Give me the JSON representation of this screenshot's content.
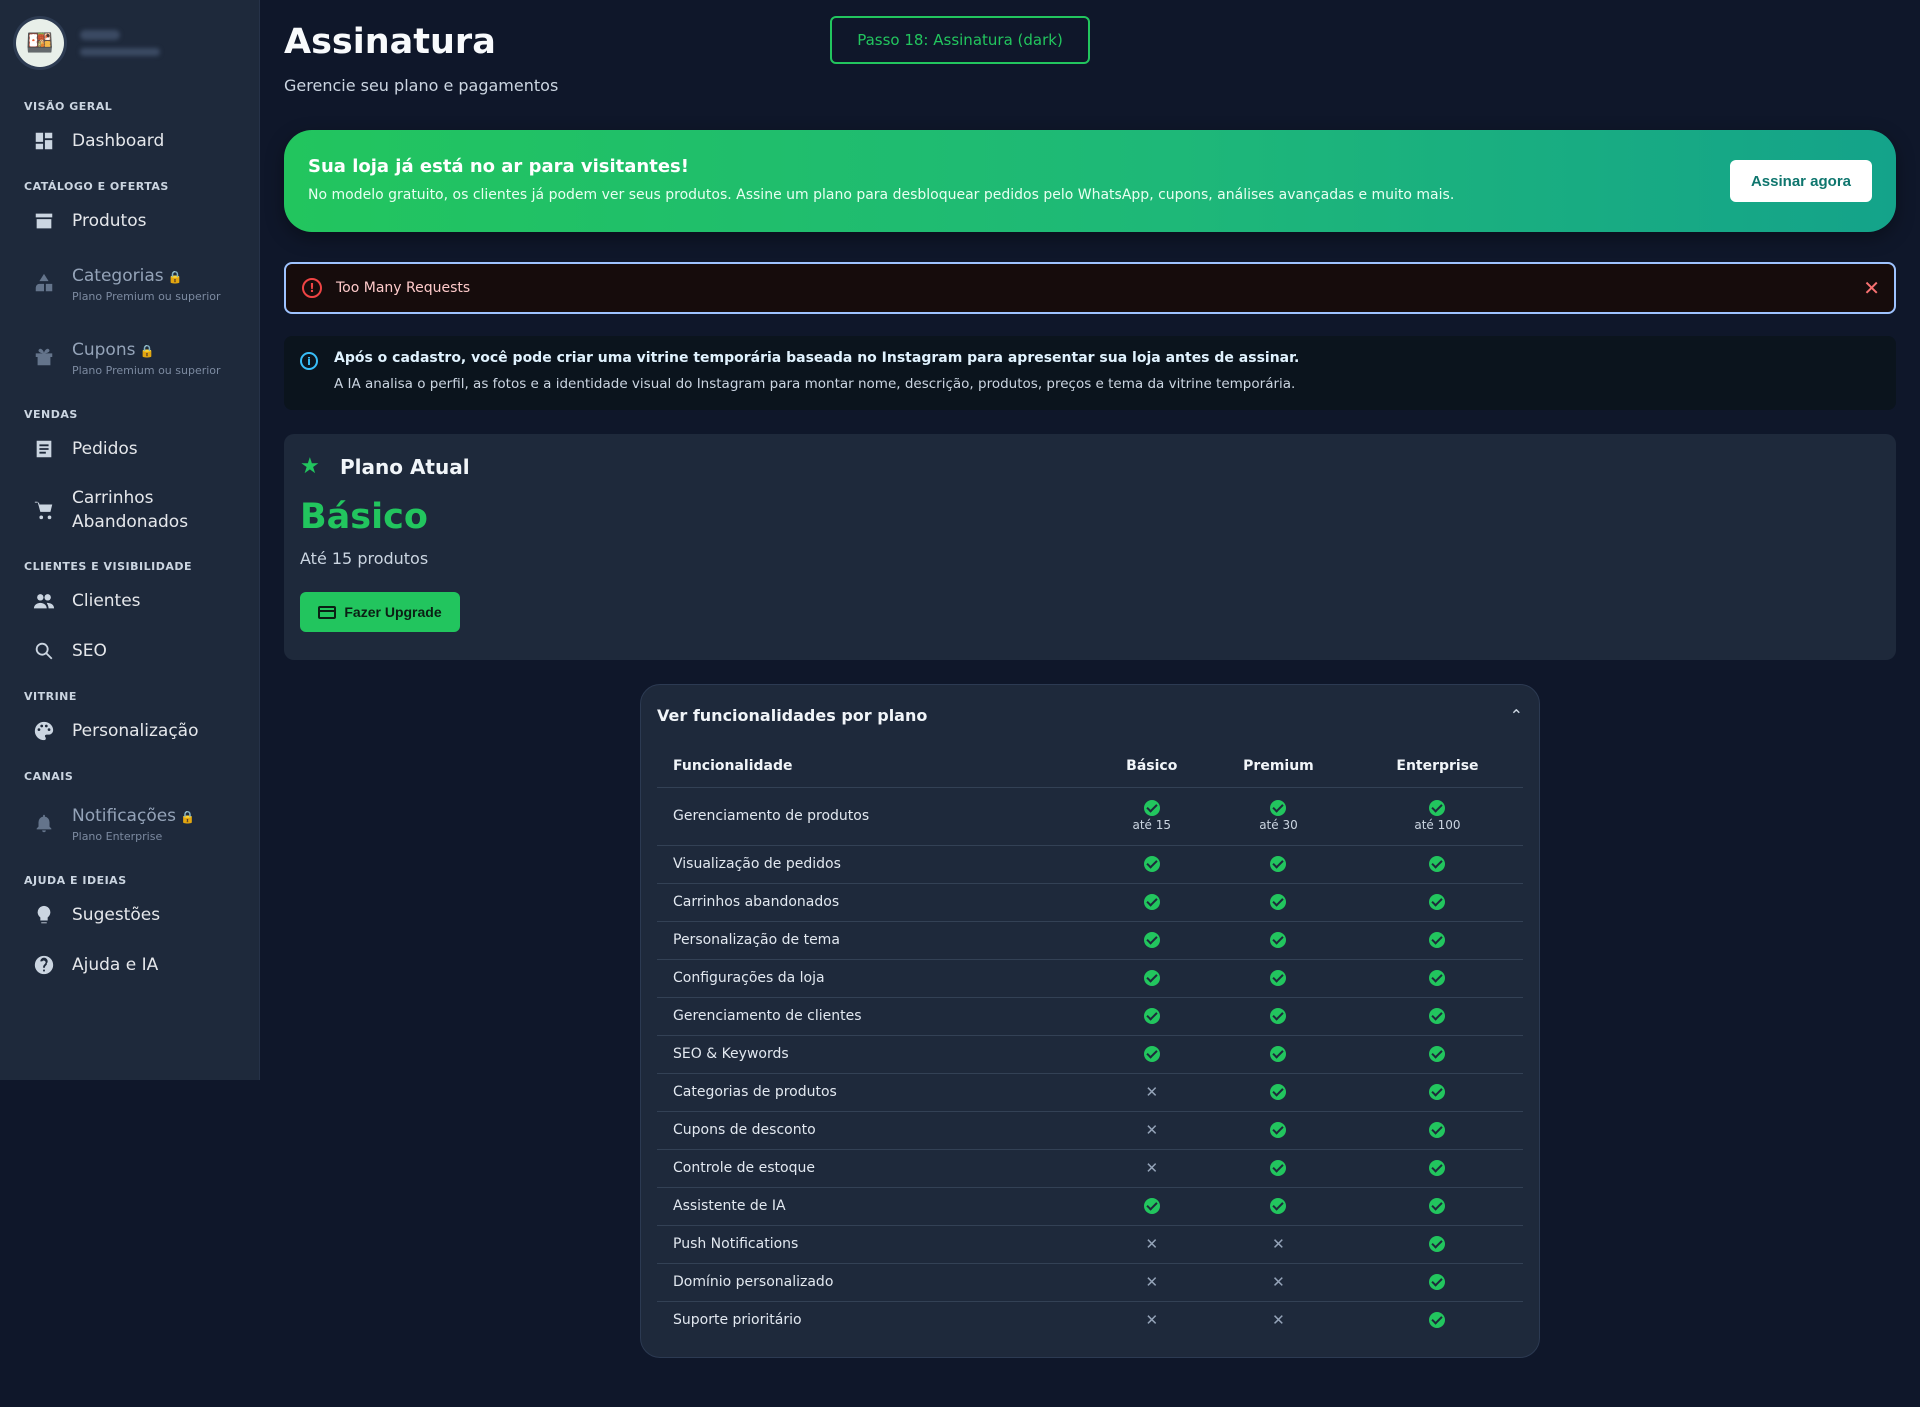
{
  "colors": {
    "accent": "#22c55e",
    "background": "#0f172a",
    "panel": "#1e293b",
    "error": "#ef4444",
    "info": "#38bdf8"
  },
  "sidebar": {
    "sections": [
      {
        "title": "VISÃO GERAL",
        "items": [
          {
            "label": "Dashboard",
            "icon": "dashboard-icon"
          }
        ]
      },
      {
        "title": "CATÁLOGO E OFERTAS",
        "items": [
          {
            "label": "Produtos",
            "icon": "store-icon"
          },
          {
            "label": "Categorias",
            "icon": "category-icon",
            "locked": true,
            "sub": "Plano Premium ou superior"
          },
          {
            "label": "Cupons",
            "icon": "gift-icon",
            "locked": true,
            "sub": "Plano Premium ou superior"
          }
        ]
      },
      {
        "title": "VENDAS",
        "items": [
          {
            "label": "Pedidos",
            "icon": "receipt-icon"
          },
          {
            "label": "Carrinhos Abandonados",
            "icon": "cart-icon"
          }
        ]
      },
      {
        "title": "CLIENTES E VISIBILIDADE",
        "items": [
          {
            "label": "Clientes",
            "icon": "people-icon"
          },
          {
            "label": "SEO",
            "icon": "search-icon"
          }
        ]
      },
      {
        "title": "VITRINE",
        "items": [
          {
            "label": "Personalização",
            "icon": "palette-icon"
          }
        ]
      },
      {
        "title": "CANAIS",
        "items": [
          {
            "label": "Notificações",
            "icon": "bell-icon",
            "locked": true,
            "sub": "Plano Enterprise"
          }
        ]
      },
      {
        "title": "AJUDA E IDEIAS",
        "items": [
          {
            "label": "Sugestões",
            "icon": "lightbulb-icon"
          },
          {
            "label": "Ajuda e IA",
            "icon": "help-icon"
          }
        ]
      }
    ]
  },
  "header": {
    "title": "Assinatura",
    "subtitle": "Gerencie seu plano e pagamentos",
    "step_badge": "Passo 18: Assinatura (dark)"
  },
  "promo": {
    "title": "Sua loja já está no ar para visitantes!",
    "text": "No modelo gratuito, os clientes já podem ver seus produtos. Assine um plano para desbloquear pedidos pelo WhatsApp, cupons, análises avançadas e muito mais.",
    "button": "Assinar agora"
  },
  "error": {
    "text": "Too Many Requests"
  },
  "info": {
    "title": "Após o cadastro, você pode criar uma vitrine temporária baseada no Instagram para apresentar sua loja antes de assinar.",
    "text": "A IA analisa o perfil, as fotos e a identidade visual do Instagram para montar nome, descrição, produtos, preços e tema da vitrine temporária."
  },
  "plan": {
    "heading": "Plano Atual",
    "name": "Básico",
    "limit": "Até 15 produtos",
    "upgrade": "Fazer Upgrade"
  },
  "features": {
    "title": "Ver funcionalidades por plano",
    "columns": [
      "Funcionalidade",
      "Básico",
      "Premium",
      "Enterprise"
    ],
    "rows": [
      {
        "name": "Gerenciamento de produtos",
        "values": [
          true,
          true,
          true
        ],
        "notes": [
          "até 15",
          "até 30",
          "até 100"
        ]
      },
      {
        "name": "Visualização de pedidos",
        "values": [
          true,
          true,
          true
        ]
      },
      {
        "name": "Carrinhos abandonados",
        "values": [
          true,
          true,
          true
        ]
      },
      {
        "name": "Personalização de tema",
        "values": [
          true,
          true,
          true
        ]
      },
      {
        "name": "Configurações da loja",
        "values": [
          true,
          true,
          true
        ]
      },
      {
        "name": "Gerenciamento de clientes",
        "values": [
          true,
          true,
          true
        ]
      },
      {
        "name": "SEO & Keywords",
        "values": [
          true,
          true,
          true
        ]
      },
      {
        "name": "Categorias de produtos",
        "values": [
          false,
          true,
          true
        ]
      },
      {
        "name": "Cupons de desconto",
        "values": [
          false,
          true,
          true
        ]
      },
      {
        "name": "Controle de estoque",
        "values": [
          false,
          true,
          true
        ]
      },
      {
        "name": "Assistente de IA",
        "values": [
          true,
          true,
          true
        ]
      },
      {
        "name": "Push Notifications",
        "values": [
          false,
          false,
          true
        ]
      },
      {
        "name": "Domínio personalizado",
        "values": [
          false,
          false,
          true
        ]
      },
      {
        "name": "Suporte prioritário",
        "values": [
          false,
          false,
          true
        ]
      }
    ]
  }
}
